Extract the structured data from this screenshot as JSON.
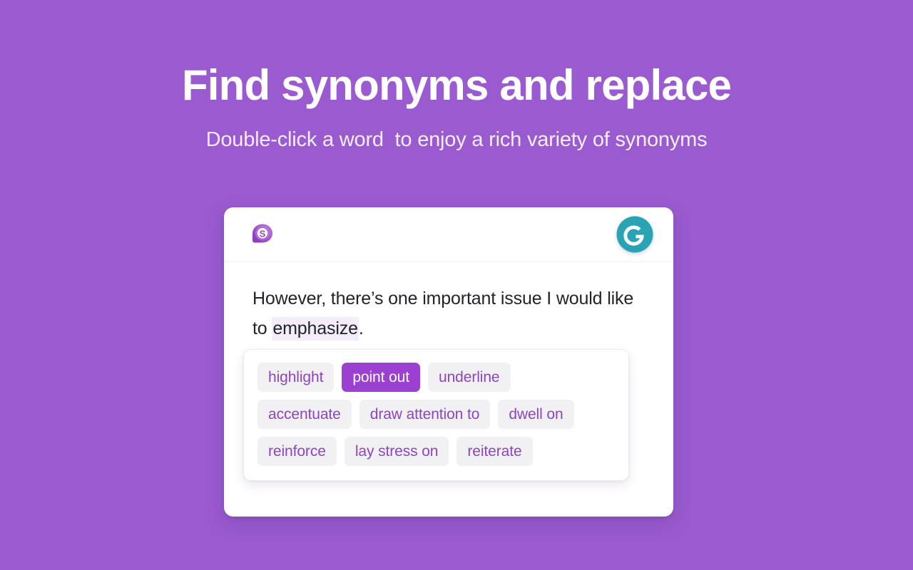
{
  "promo": {
    "headline": "Find synonyms and replace",
    "subheadline": "Double-click a word  to enjoy a rich variety of synonyms",
    "background_color": "#9a5bd0"
  },
  "card": {
    "header": {
      "left_icon_name": "synonyms-bubble-icon",
      "left_icon_letter": "S",
      "left_icon_color": "#9b45c9",
      "right_icon_name": "grammarly-logo-icon",
      "right_icon_letter": "G",
      "right_icon_color": "#2aa3b5"
    },
    "editor": {
      "sentence_before": "However, there’s one important issue I would like to ",
      "highlighted_word": "emphasize",
      "sentence_after": ".",
      "highlight_color": "#f4edf9",
      "text_color": "#21242c"
    },
    "synonyms_panel": {
      "selected_synonym": "point out",
      "chip_color": "#f1f0f2",
      "chip_text_color": "#8e44c4",
      "selected_chip_color": "#9b40d0",
      "rows": [
        [
          {
            "label": "highlight",
            "selected": false
          },
          {
            "label": "point out",
            "selected": true
          },
          {
            "label": "underline",
            "selected": false
          }
        ],
        [
          {
            "label": "accentuate",
            "selected": false
          },
          {
            "label": "draw attention to",
            "selected": false
          },
          {
            "label": "dwell on",
            "selected": false
          }
        ],
        [
          {
            "label": "reinforce",
            "selected": false
          },
          {
            "label": "lay stress on",
            "selected": false
          },
          {
            "label": "reiterate",
            "selected": false
          }
        ]
      ]
    }
  }
}
